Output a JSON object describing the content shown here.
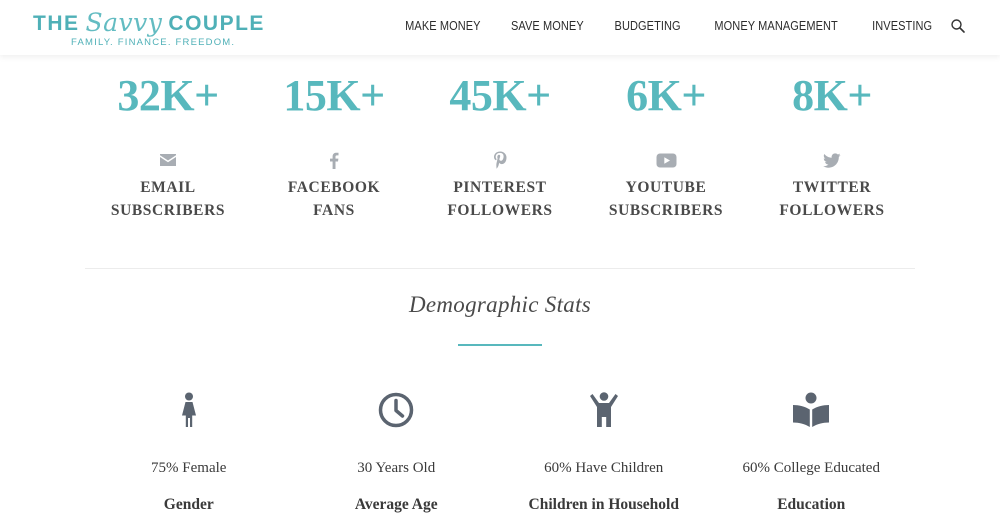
{
  "logo": {
    "part1": "THE",
    "script": "Savvy",
    "part2": "COUPLE",
    "tagline": "FAMILY. FINANCE. FREEDOM."
  },
  "nav": {
    "items": [
      "MAKE MONEY",
      "SAVE MONEY",
      "BUDGETING",
      "MONEY MANAGEMENT",
      "INVESTING"
    ],
    "search_icon": "search-icon"
  },
  "social_stats": [
    {
      "count": "32K+",
      "icon": "envelope-icon",
      "label_line1": "EMAIL",
      "label_line2": "SUBSCRIBERS"
    },
    {
      "count": "15K+",
      "icon": "facebook-icon",
      "label_line1": "FACEBOOK",
      "label_line2": "FANS"
    },
    {
      "count": "45K+",
      "icon": "pinterest-icon",
      "label_line1": "PINTEREST",
      "label_line2": "FOLLOWERS"
    },
    {
      "count": "6K+",
      "icon": "youtube-icon",
      "label_line1": "YOUTUBE",
      "label_line2": "SUBSCRIBERS"
    },
    {
      "count": "8K+",
      "icon": "twitter-icon",
      "label_line1": "TWITTER",
      "label_line2": "FOLLOWERS"
    }
  ],
  "demographics": {
    "title": "Demographic Stats",
    "items": [
      {
        "icon": "female-icon",
        "value": "75% Female",
        "label": "Gender"
      },
      {
        "icon": "clock-icon",
        "value": "30 Years Old",
        "label": "Average Age"
      },
      {
        "icon": "child-icon",
        "value": "60% Have Children",
        "label": "Children in Household"
      },
      {
        "icon": "book-icon",
        "value": "60% College Educated",
        "label": "Education"
      }
    ]
  },
  "colors": {
    "accent": "#58b8bd",
    "icon_gray": "#a8adb3",
    "demo_icon": "#5b6470",
    "text": "#4a4a4a"
  }
}
